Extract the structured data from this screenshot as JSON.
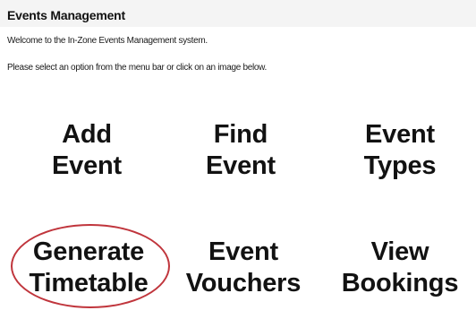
{
  "header": {
    "title": "Events Management"
  },
  "intro": {
    "line1": "Welcome to the In-Zone Events Management system.",
    "line2": "Please select an option from the menu bar or click on an image below."
  },
  "tiles": [
    {
      "line1": "Add",
      "line2": "Event"
    },
    {
      "line1": "Find",
      "line2": "Event"
    },
    {
      "line1": "Event",
      "line2": "Types"
    },
    {
      "line1": "Generate",
      "line2": "Timetable"
    },
    {
      "line1": "Event",
      "line2": "Vouchers"
    },
    {
      "line1": "View",
      "line2": "Bookings"
    }
  ],
  "colors": {
    "highlight_ring": "#c0353c",
    "header_background": "#f4f4f4"
  }
}
